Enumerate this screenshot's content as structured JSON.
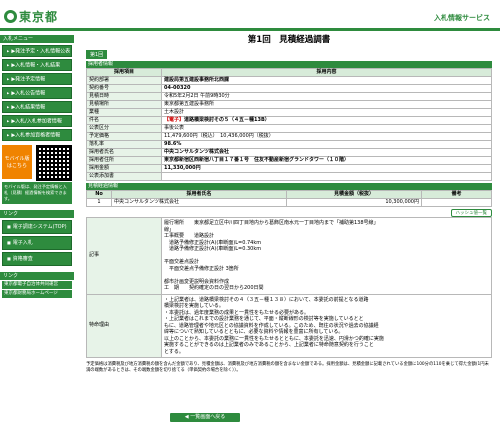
{
  "header": {
    "logo_text": "東京都",
    "service_name": "入札情報サービス"
  },
  "sidebar": {
    "menu_title": "入札メニュー",
    "items": [
      "▶発注予定・入札情報公表",
      "▶入札情報・入札結果",
      "▶発注予定情報",
      "▶入札公告情報",
      "▶入札結果情報",
      "▶入札/入札参加者情報",
      "▶入札参加資格者情報"
    ],
    "mobile_label": "モバイル版",
    "mobile_sub": "はこちら",
    "mobile_note": "モバイル版は、発注予定情報と入札（見積）経過情報を検索できます。",
    "links_title": "リンク",
    "links": [
      "電子調達システム(TOP)",
      "電子入札",
      "資格審査"
    ],
    "bottom_title": "リンク",
    "bottom_links": [
      "東京都電子自治体共同運営",
      "東京都財務局ホームページ"
    ]
  },
  "main": {
    "title": "第1回　見積経過調書",
    "round_badge": "第1回",
    "section_info": "採用者情報",
    "table_headers": {
      "item": "採用項目",
      "content": "採用内容"
    },
    "rows": [
      {
        "label": "契約部署",
        "value": "建設局第五建設事務所北西課"
      },
      {
        "label": "契約番号",
        "value": "04-00320"
      },
      {
        "label": "見積日時",
        "value": "令和5年2月2日 午前9時30分"
      },
      {
        "label": "見積場所",
        "value": "東京都第五建設事務所"
      },
      {
        "label": "業種",
        "value": "土木設計"
      },
      {
        "label": "件名",
        "value_prefix": "【電子】",
        "value": "道路橋梁検討その５（４五－種13B）"
      },
      {
        "label": "公表区分",
        "value": "事後公表"
      },
      {
        "label": "予定価格",
        "value": "11,479,600円（税込）　10,436,000円（税抜）"
      },
      {
        "label": "落札率",
        "value": "98.6%"
      },
      {
        "label": "採用者氏名",
        "value": "中央コンサルタンツ株式会社"
      },
      {
        "label": "採用者住所",
        "value": "東京都新宿区西新宿八丁目１７番１号　住友不動産新宿グランドタワー（１０階）"
      },
      {
        "label": "採用金額",
        "value": "11,330,000円"
      },
      {
        "label": "公表添加書",
        "value": ""
      }
    ],
    "section_bid": "見積経過情報",
    "bid_headers": {
      "no": "No",
      "name": "採用者氏名",
      "amount": "見積金額（税抜）",
      "note": "備考"
    },
    "bid_rows": [
      {
        "no": "1",
        "name": "中央コンサルタンツ株式会社",
        "amount": "10,300,000円",
        "note": ""
      }
    ],
    "hash_button": "ハッシュ値一覧",
    "remarks_label": "記事",
    "remarks": [
      "履行場所　　東京都足立区中川四丁目地内から葛飾区南水元一丁目地内まで「補助第138号線」",
      "線」",
      "工事概要　　道路設計",
      "　道路予備修正設計(A)(車断面)L=0.74km",
      "　道路予備修正設計(A)(車断面)L=0.30km",
      "",
      "平面交差点設計",
      "　平面交差点予備修正設計 3箇所",
      "",
      "都市計画変更説明会資料作成",
      "工　期　　契約確定の日の翌日から200日間"
    ],
    "reason_label": "特命理由",
    "reason": [
      "・上記業者は、道路橋梁検討その４（３五－種１３８）において、本委託の前提となる道路",
      "橋梁検討を実施している。",
      "・本委託は、過年度業務の成果と一貫性をもたせる必要がある。",
      "・上記業者はこれまでの設計業務を通じて、平面・縦断線形の検討等を実施しているとと",
      "もに、道路管理者や地元区との協議資料を作成している。このため、既往の状況や過去の協議経",
      "緯等について熟知しているとともに、必要な資料や情報を豊富に所有している。",
      "以上のことから、本委託の業務に一貫性をもたせるとともに、本委託を迅速、円滑かつ的確に実施",
      "実施することができるのは上記業者のみであることから、上記業者に特命随意契約を行うこと",
      "とする。"
    ],
    "footnote": "予定価格は消費税及び地方消費税の額を含んだ金額であり、見積金額は、消費税及び地方消費税の額を含まない金額である。採用金額は、見積金額に記載されている金額に100分の110を乗じて得た金額(1円未満の端数があるときは、その端数金額を切り捨てる（単価契約の場合を除く））。",
    "back_button": "◀ 一覧画面へ戻る"
  }
}
